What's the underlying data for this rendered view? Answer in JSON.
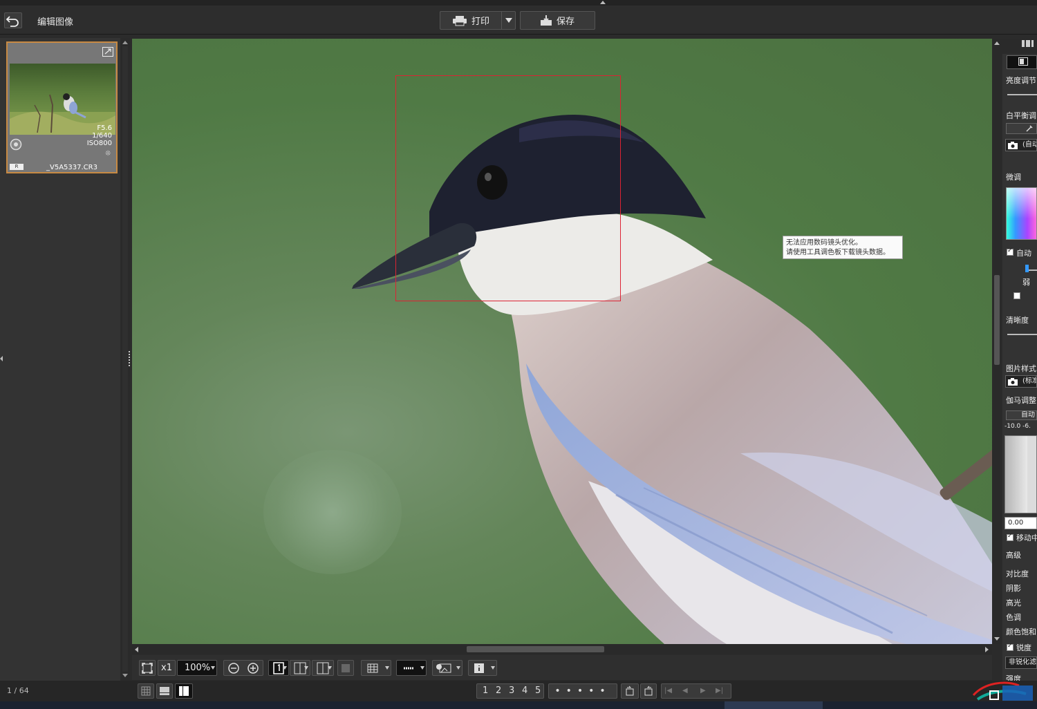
{
  "header": {
    "title": "编辑图像",
    "print_label": "打印",
    "save_label": "保存"
  },
  "thumbnail": {
    "aperture": "F5.6",
    "shutter": "1/640",
    "iso": "ISO800",
    "raw_badge": "R",
    "filename": "_V5A5337.CR3"
  },
  "viewer": {
    "tooltip_line1": "无法应用数码镜头优化。",
    "tooltip_line2": "请使用工具调色板下载镜头数据。"
  },
  "view_toolbar": {
    "zoom_x1": "x1",
    "zoom_value": "100%"
  },
  "status": {
    "page_counter": "1 / 64",
    "ratings": [
      "1",
      "2",
      "3",
      "4",
      "5"
    ]
  },
  "right_panel": {
    "brightness_label": "亮度调节",
    "white_balance_label": "白平衡调",
    "wb_value": "(自动",
    "fine_tune_label": "微调",
    "auto_label": "自动",
    "weak_label": "弱",
    "clarity_label": "清晰度",
    "picture_style_label": "图片样式",
    "ps_value": "(标准",
    "gamma_label": "伽马调整",
    "gamma_auto": "自动",
    "gamma_range": "-10.0  -6.",
    "gamma_value": "0.00",
    "move_label": "移动中",
    "advanced_label": "高级",
    "contrast_label": "对比度",
    "shadow_label": "阴影",
    "highlight_label": "高光",
    "tone_label": "色调",
    "saturation_label": "颜色饱和",
    "sharpness_label": "锐度",
    "unsharp_label": "非锐化滤",
    "strength_label": "强度"
  },
  "colors": {
    "accent_orange": "#c88a43",
    "focus_red": "#d22233"
  }
}
